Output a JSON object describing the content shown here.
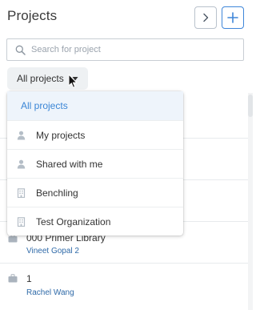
{
  "header": {
    "title": "Projects",
    "expand_icon": "chevron-right-icon",
    "add_icon": "plus-icon"
  },
  "search": {
    "placeholder": "Search for project",
    "value": "",
    "icon": "search-icon"
  },
  "filter": {
    "selected": "All projects",
    "icon": "caret-down-icon"
  },
  "dropdown": {
    "options": [
      {
        "label": "All projects",
        "icon": "",
        "selected": true
      },
      {
        "label": "My projects",
        "icon": "person-icon",
        "selected": false
      },
      {
        "label": "Shared with me",
        "icon": "person-icon",
        "selected": false
      },
      {
        "label": "Benchling",
        "icon": "building-icon",
        "selected": false
      },
      {
        "label": "Test Organization",
        "icon": "building-icon",
        "selected": false
      }
    ]
  },
  "projects": [
    {
      "name": "000 Primer Library",
      "owner": "Vineet Gopal 2",
      "icon": "briefcase-icon"
    },
    {
      "name": "1",
      "owner": "Rachel Wang",
      "icon": "briefcase-icon"
    }
  ],
  "colors": {
    "accent": "#3f86d9",
    "selected_bg": "#eef4fb",
    "selected_text": "#3b86d6",
    "owner_text": "#2f6aa8",
    "filter_bg": "#eef1f3"
  }
}
